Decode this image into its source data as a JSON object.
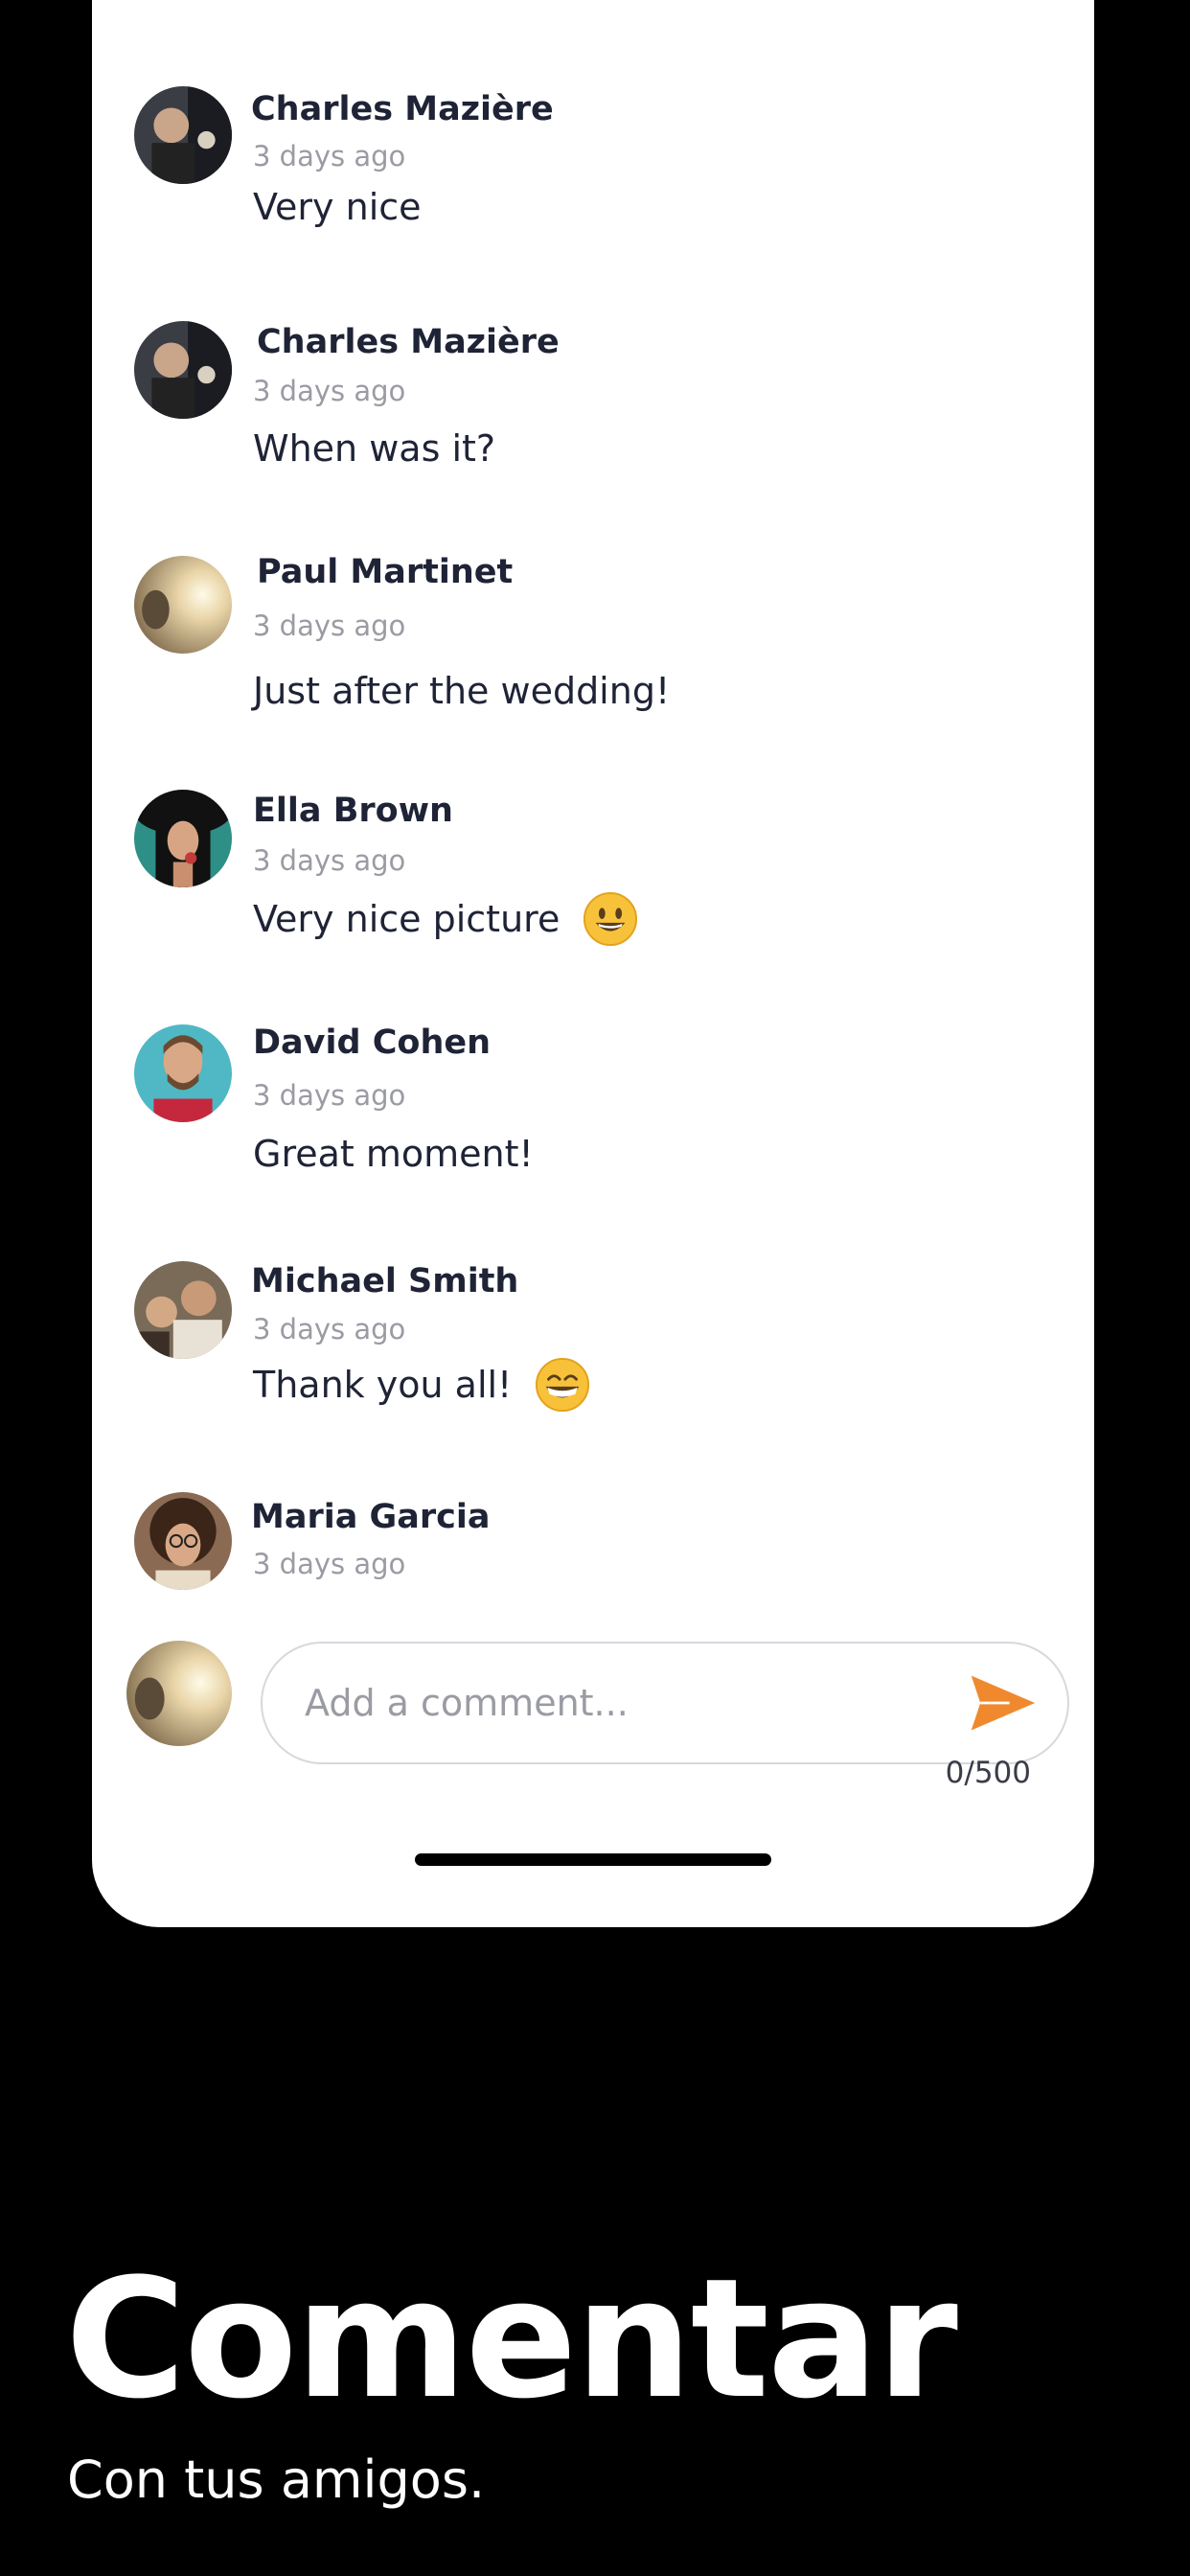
{
  "comments": [
    {
      "name": "Charles Mazière",
      "time": "3 days ago",
      "text": "Very nice",
      "avatar": "charles-avatar",
      "emoji": ""
    },
    {
      "name": "Charles Mazière",
      "time": "3 days ago",
      "text": "When was it?",
      "avatar": "charles-avatar",
      "emoji": ""
    },
    {
      "name": "Paul Martinet",
      "time": "3 days ago",
      "text": "Just after the wedding!",
      "avatar": "paul-avatar",
      "emoji": ""
    },
    {
      "name": "Ella Brown",
      "time": "3 days ago",
      "text": "Very nice picture",
      "avatar": "ella-avatar",
      "emoji": "grinning-face"
    },
    {
      "name": "David Cohen",
      "time": "3 days ago",
      "text": "Great moment!",
      "avatar": "david-avatar",
      "emoji": ""
    },
    {
      "name": "Michael Smith",
      "time": "3 days ago",
      "text": "Thank you all!",
      "avatar": "michael-avatar",
      "emoji": "beaming-face"
    },
    {
      "name": "Maria Garcia",
      "time": "3 days ago",
      "text": "",
      "avatar": "maria-avatar",
      "emoji": ""
    }
  ],
  "composer": {
    "placeholder": "Add a comment...",
    "value": "",
    "char_count": "0/500",
    "send_icon": "send-icon"
  },
  "promo": {
    "headline": "Comentar",
    "subline": "Con tus amigos."
  },
  "colors": {
    "accent": "#f0892e",
    "text_primary": "#1f2336",
    "text_muted": "#9a9ba3",
    "background": "#000000",
    "card": "#ffffff"
  }
}
